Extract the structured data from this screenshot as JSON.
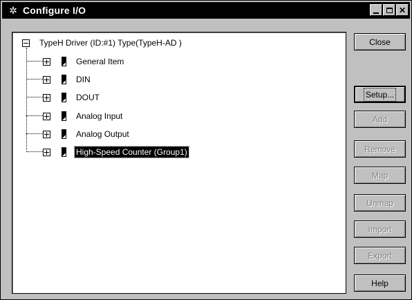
{
  "window": {
    "title": "Configure I/O",
    "title_icon": "gear-icon",
    "controls": [
      "minimize-icon",
      "maximize-icon",
      "close-icon"
    ]
  },
  "tree": {
    "root": "TypeH Driver (ID:#1) Type(TypeH-AD )",
    "items": [
      {
        "label": "General Item",
        "selected": false
      },
      {
        "label": "DIN",
        "selected": false
      },
      {
        "label": "DOUT",
        "selected": false
      },
      {
        "label": "Analog Input",
        "selected": false
      },
      {
        "label": "Analog Output",
        "selected": false
      },
      {
        "label": "High-Speed Counter (Group1)",
        "selected": true
      }
    ]
  },
  "buttons": {
    "close": "Close",
    "setup": "Setup...",
    "add": "Add",
    "remove": "Remove",
    "map": "Map",
    "unmap": "Unmap",
    "import": "Import",
    "export": "Export",
    "help": "Help"
  }
}
